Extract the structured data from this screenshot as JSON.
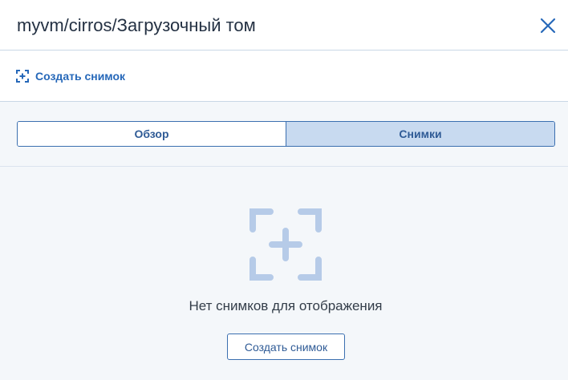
{
  "header": {
    "title": "myvm/cirros/Загрузочный том"
  },
  "toolbar": {
    "create_snapshot_label": "Создать снимок"
  },
  "tabs": [
    {
      "label": "Обзор",
      "active": false
    },
    {
      "label": "Снимки",
      "active": true
    }
  ],
  "empty_state": {
    "message": "Нет снимков для отображения",
    "button_label": "Создать снимок"
  },
  "colors": {
    "accent": "#2668b9",
    "tab_active_bg": "#c8daf0",
    "empty_icon": "#b6cbe8",
    "background": "#f4f7fa"
  },
  "icons": {
    "close": "close-icon",
    "toolbar_snapshot": "snapshot-add-icon",
    "empty_state": "snapshot-add-icon"
  }
}
